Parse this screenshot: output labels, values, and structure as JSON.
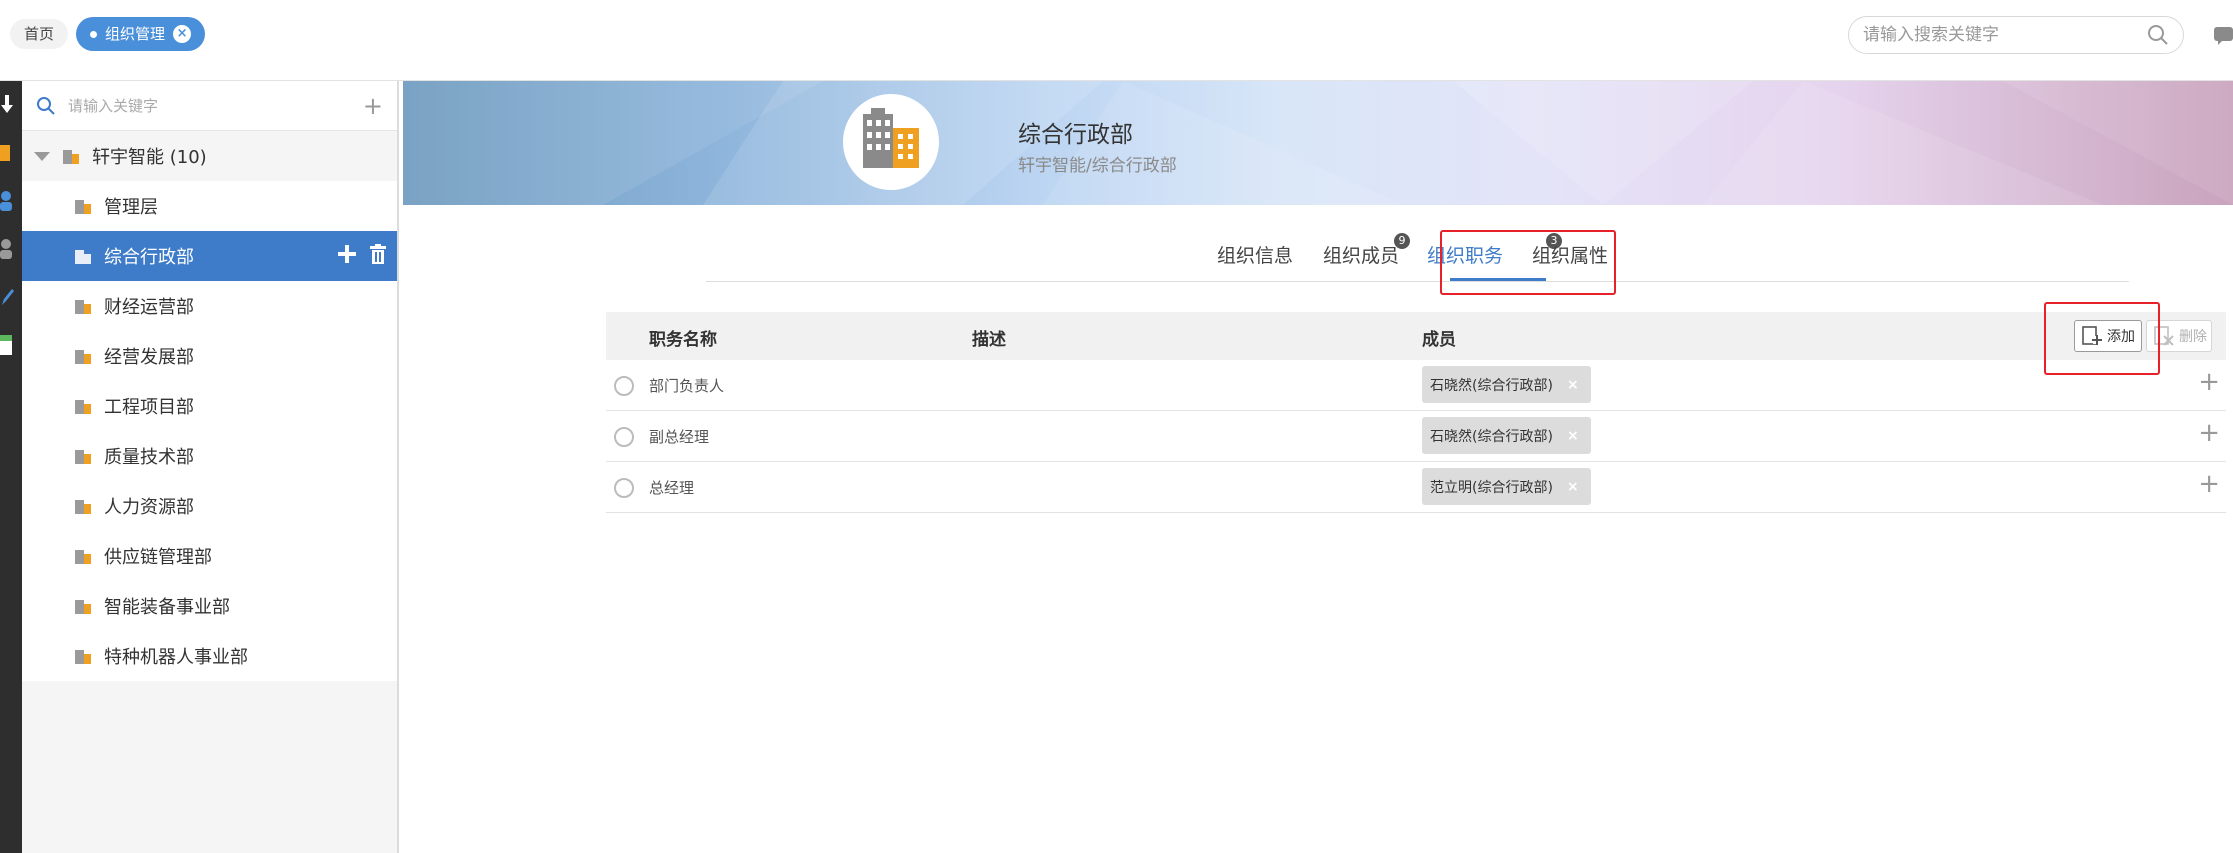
{
  "header": {
    "tabs": [
      {
        "label": "首页"
      },
      {
        "label": "组织管理"
      }
    ],
    "search_placeholder": "请输入搜索关键字"
  },
  "sidebar": {
    "search_placeholder": "请输入关键字",
    "root": {
      "label": "轩宇智能 (10)"
    },
    "items": [
      {
        "label": "管理层"
      },
      {
        "label": "综合行政部"
      },
      {
        "label": "财经运营部"
      },
      {
        "label": "经营发展部"
      },
      {
        "label": "工程项目部"
      },
      {
        "label": "质量技术部"
      },
      {
        "label": "人力资源部"
      },
      {
        "label": "供应链管理部"
      },
      {
        "label": "智能装备事业部"
      },
      {
        "label": "特种机器人事业部"
      }
    ]
  },
  "banner": {
    "name": "综合行政部",
    "path": "轩宇智能/综合行政部"
  },
  "tabs": [
    {
      "label": "组织信息",
      "badge": ""
    },
    {
      "label": "组织成员",
      "badge": "9"
    },
    {
      "label": "组织职务",
      "badge": "3"
    },
    {
      "label": "组织属性",
      "badge": ""
    }
  ],
  "toolbar": {
    "add_label": "添加",
    "delete_label": "删除"
  },
  "table": {
    "columns": [
      "职务名称",
      "描述",
      "成员"
    ],
    "rows": [
      {
        "name": "部门负责人",
        "desc": "",
        "member": "石晓然(综合行政部)"
      },
      {
        "name": "副总经理",
        "desc": "",
        "member": "石晓然(综合行政部)"
      },
      {
        "name": "总经理",
        "desc": "",
        "member": "范立明(综合行政部)"
      }
    ]
  },
  "colors": {
    "accent": "#3e7bc8",
    "tab_pill": "#4a8fd9",
    "highlight": "#e8202a"
  }
}
